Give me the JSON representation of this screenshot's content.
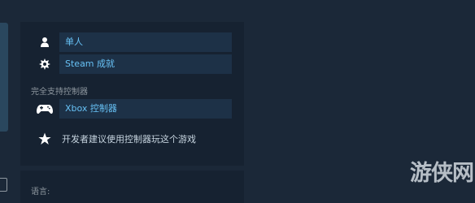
{
  "features": {
    "items": [
      {
        "label": "单人",
        "icon": "person-icon"
      },
      {
        "label": "Steam 成就",
        "icon": "achievement-icon"
      }
    ]
  },
  "controller_section": {
    "title": "完全支持控制器",
    "xbox_label": "Xbox 控制器",
    "xbox_icon": "gamepad-icon",
    "recommend_text": "开发者建议使用控制器玩这个游戏",
    "recommend_icon": "star-icon"
  },
  "languages": {
    "label": "语言:"
  },
  "watermark": {
    "text": "游侠网"
  },
  "colors": {
    "background": "#1b2838",
    "panel": "#162231",
    "row": "#1d3147",
    "link": "#67c1f5",
    "muted": "#8f98a0",
    "text": "#c6d4df"
  }
}
